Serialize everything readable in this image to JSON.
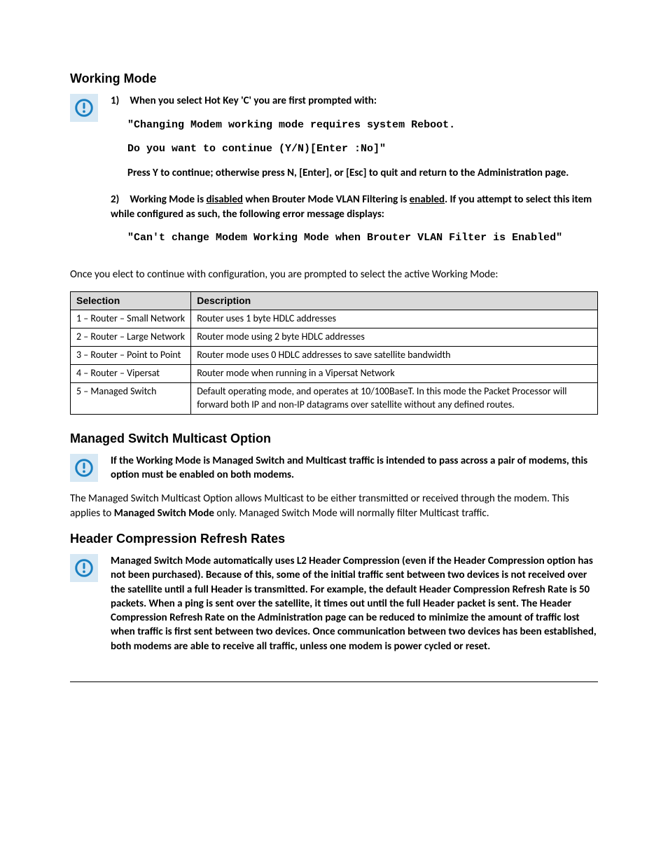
{
  "section1": {
    "heading": "Working Mode",
    "item1_lead": "When you select Hot Key 'C' you are first prompted with:",
    "item1_code1": "\"Changing Modem working mode requires system Reboot.",
    "item1_code2": "Do you want to continue (Y/N)[Enter  :No]\"",
    "item1_tail": "Press Y to continue; otherwise press N, [Enter], or [Esc] to quit and return to the Administration page.",
    "item2_pre": "Working Mode is ",
    "item2_u1": "disabled",
    "item2_mid": " when Brouter Mode VLAN Filtering is ",
    "item2_u2": "enabled",
    "item2_post": ". If you attempt to select this item while configured as such, the following error message displays:",
    "item2_code": "\"Can't change Modem Working Mode when Brouter VLAN Filter is Enabled\"",
    "after": "Once you elect to continue with configuration, you are prompted to select the active Working Mode:"
  },
  "table": {
    "h1": "Selection",
    "h2": "Description",
    "rows": [
      {
        "s": "1 – Router – Small Network",
        "d": "Router uses 1 byte HDLC addresses"
      },
      {
        "s": "2 – Router – Large Network",
        "d": "Router mode using 2 byte HDLC addresses"
      },
      {
        "s": "3 – Router – Point to Point",
        "d": "Router mode uses 0 HDLC addresses to save satellite bandwidth"
      },
      {
        "s": "4 – Router – Vipersat",
        "d": "Router mode when running in a Vipersat Network"
      },
      {
        "s": "5 – Managed Switch",
        "d": "Default operating mode, and operates at 10/100BaseT. In this mode the Packet Processor will forward both IP and non-IP datagrams over satellite without any defined routes."
      }
    ]
  },
  "section2": {
    "heading": "Managed Switch Multicast Option",
    "notice": "If the Working Mode is Managed Switch and Multicast traffic is intended to pass across a pair of modems, this option must be enabled on both modems.",
    "body_pre": "The Managed Switch Multicast Option allows Multicast to be either transmitted or received through the modem. This applies to ",
    "body_bold": "Managed Switch Mode",
    "body_post": " only. Managed Switch Mode will normally filter Multicast traffic."
  },
  "section3": {
    "heading": "Header Compression Refresh Rates",
    "notice": "Managed Switch Mode automatically uses L2 Header Compression (even if the Header Compression option has not been purchased). Because of this, some of the initial traffic sent between two devices is not received over the satellite until a full Header is transmitted. For example, the default Header Compression Refresh Rate is 50 packets. When a ping is sent over the satellite, it times out until the full Header packet is sent. The Header Compression Refresh Rate on the Administration page can be reduced to minimize the amount of traffic lost when traffic is first sent between two devices. Once communication between two devices has been established, both modems are able to receive all traffic, unless one modem is power cycled or reset."
  }
}
